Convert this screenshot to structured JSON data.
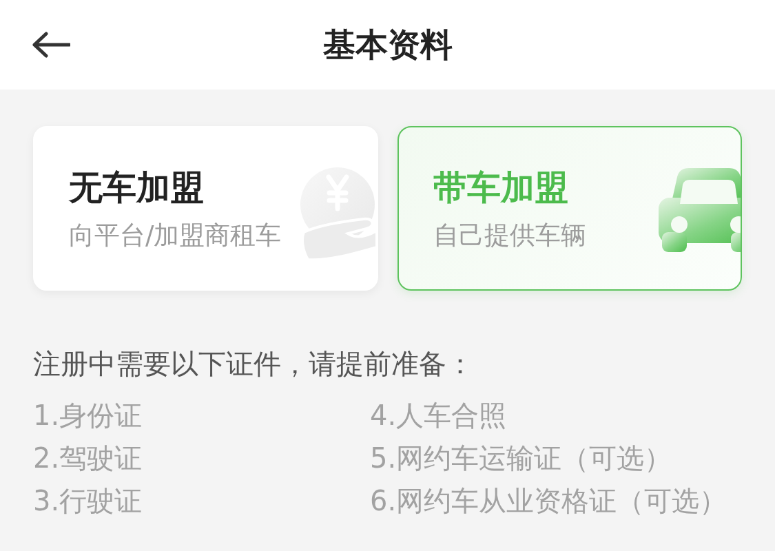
{
  "header": {
    "title": "基本资料"
  },
  "plans": [
    {
      "kind": "rent",
      "title": "无车加盟",
      "subtitle": "向平台/加盟商租车",
      "selected": false
    },
    {
      "kind": "own",
      "title": "带车加盟",
      "subtitle": "自己提供车辆",
      "selected": true
    }
  ],
  "requirements": {
    "heading": "注册中需要以下证件，请提前准备：",
    "items": [
      "1.身份证",
      "2.驾驶证",
      "3.行驶证",
      "4.人车合照",
      "5.网约车运输证（可选）",
      "6.网约车从业资格证（可选）"
    ]
  }
}
